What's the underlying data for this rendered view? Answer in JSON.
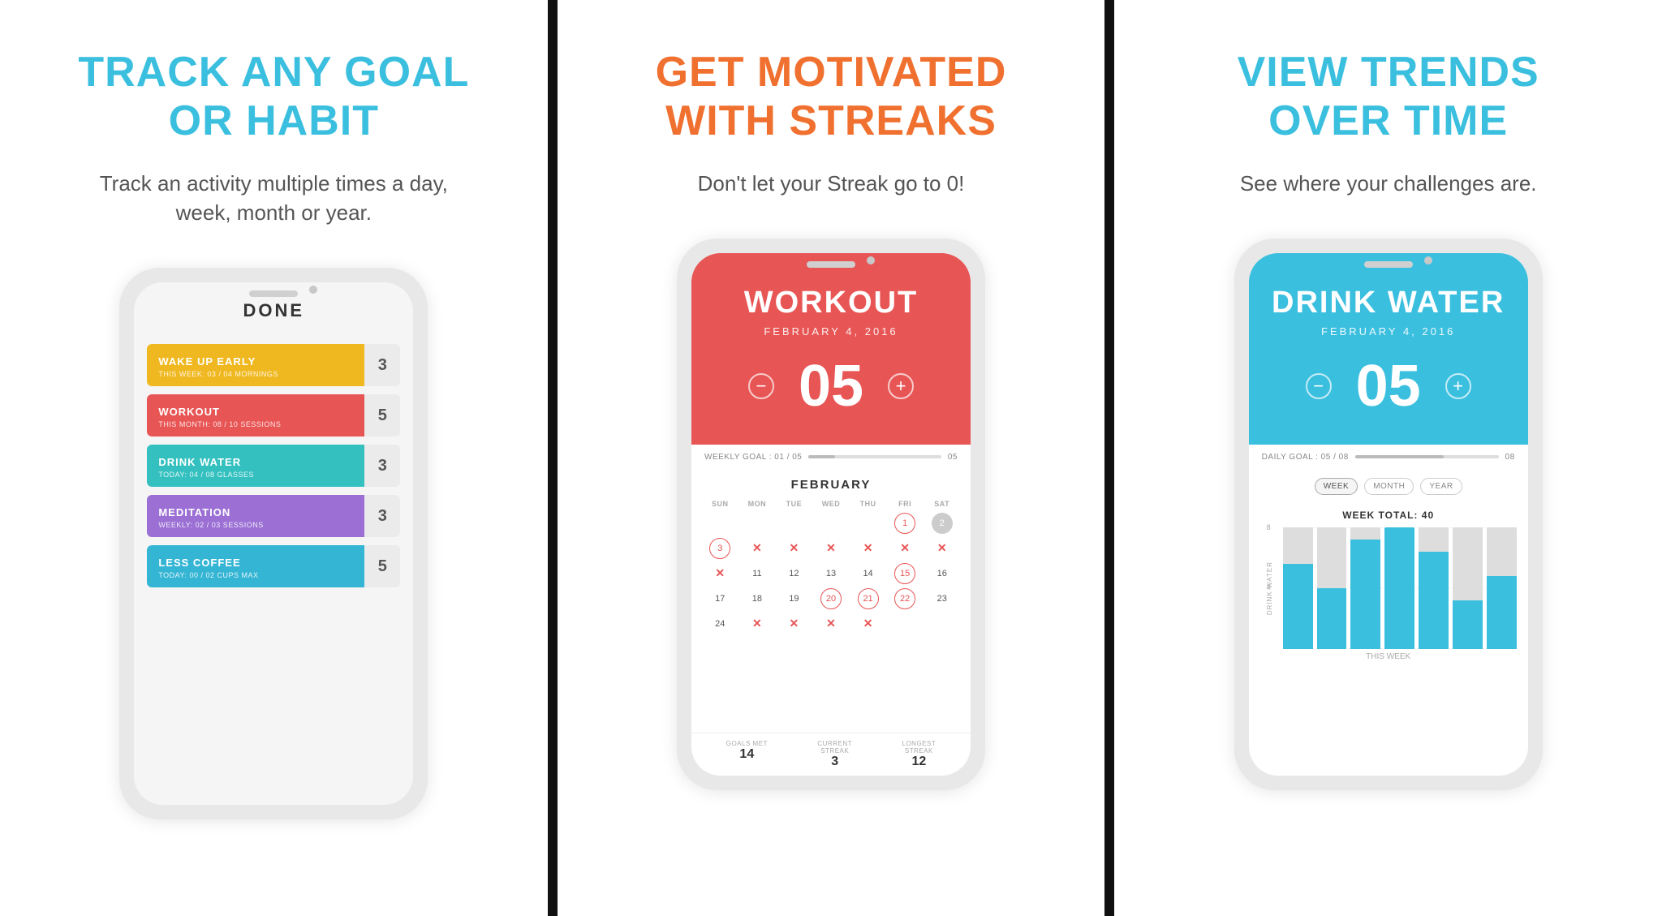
{
  "panel1": {
    "title": "TRACK ANY GOAL\nOR HABIT",
    "title_line1": "TRACK ANY GOAL",
    "title_line2": "OR HABIT",
    "subtitle": "Track an activity multiple times a day, week, month or year.",
    "done_label": "DONE",
    "goals": [
      {
        "name": "WAKE UP EARLY",
        "sub": "THIS WEEK: 03 / 04 MORNINGS",
        "count": "3",
        "color": "bg-yellow"
      },
      {
        "name": "WORKOUT",
        "sub": "THIS MONTH: 08 / 10 SESSIONS",
        "count": "5",
        "color": "bg-red"
      },
      {
        "name": "DRINK WATER",
        "sub": "TODAY: 04 / 08 GLASSES",
        "count": "3",
        "color": "bg-teal"
      },
      {
        "name": "MEDITATION",
        "sub": "WEEKLY: 02 / 03 SESSIONS",
        "count": "3",
        "color": "bg-purple"
      },
      {
        "name": "LESS COFFEE",
        "sub": "TODAY: 00 / 02 CUPS MAX",
        "count": "5",
        "color": "bg-blue"
      }
    ]
  },
  "panel2": {
    "title": "GET MOTIVATED\nWITH STREAKS",
    "title_line1": "GET MOTIVATED",
    "title_line2": "WITH STREAKS",
    "subtitle": "Don't let your Streak go to 0!",
    "workout_label": "WORKOUT",
    "date_label": "FEBRUARY 4, 2016",
    "count": "05",
    "goal_label": "WEEKLY GOAL : 01 / 05",
    "goal_progress": 20,
    "goal_right": "05",
    "calendar_month": "FEBRUARY",
    "cal_headers": [
      "SUN",
      "MON",
      "TUE",
      "WED",
      "THU",
      "FRI",
      "SAT"
    ],
    "stats": [
      {
        "label": "GOALS MET",
        "value": "14"
      },
      {
        "label": "CURRENT\nSTREAK",
        "value": "3"
      },
      {
        "label": "LONGEST\nSTREAK",
        "value": "12"
      }
    ]
  },
  "panel3": {
    "title": "VIEW TRENDS\nOVER TIME",
    "title_line1": "VIEW TRENDS",
    "title_line2": "OVER TIME",
    "subtitle": "See where your challenges are.",
    "drink_water_label": "DRINK WATER",
    "date_label": "FEBRUARY 4, 2016",
    "count": "05",
    "goal_label": "DAILY GOAL : 05 / 08",
    "goal_right": "08",
    "tabs": [
      "WEEK",
      "MONTH",
      "YEAR"
    ],
    "active_tab": "WEEK",
    "chart_title": "WEEK TOTAL: 40",
    "y_axis_label": "DRINK WATER",
    "y_labels": [
      "8",
      "4"
    ],
    "bars": [
      {
        "teal": 70,
        "gray": 30
      },
      {
        "teal": 50,
        "gray": 50
      },
      {
        "teal": 90,
        "gray": 10
      },
      {
        "teal": 100,
        "gray": 0
      },
      {
        "teal": 80,
        "gray": 20
      },
      {
        "teal": 40,
        "gray": 60
      },
      {
        "teal": 60,
        "gray": 40
      }
    ],
    "week_label": "THIS WEEK"
  }
}
